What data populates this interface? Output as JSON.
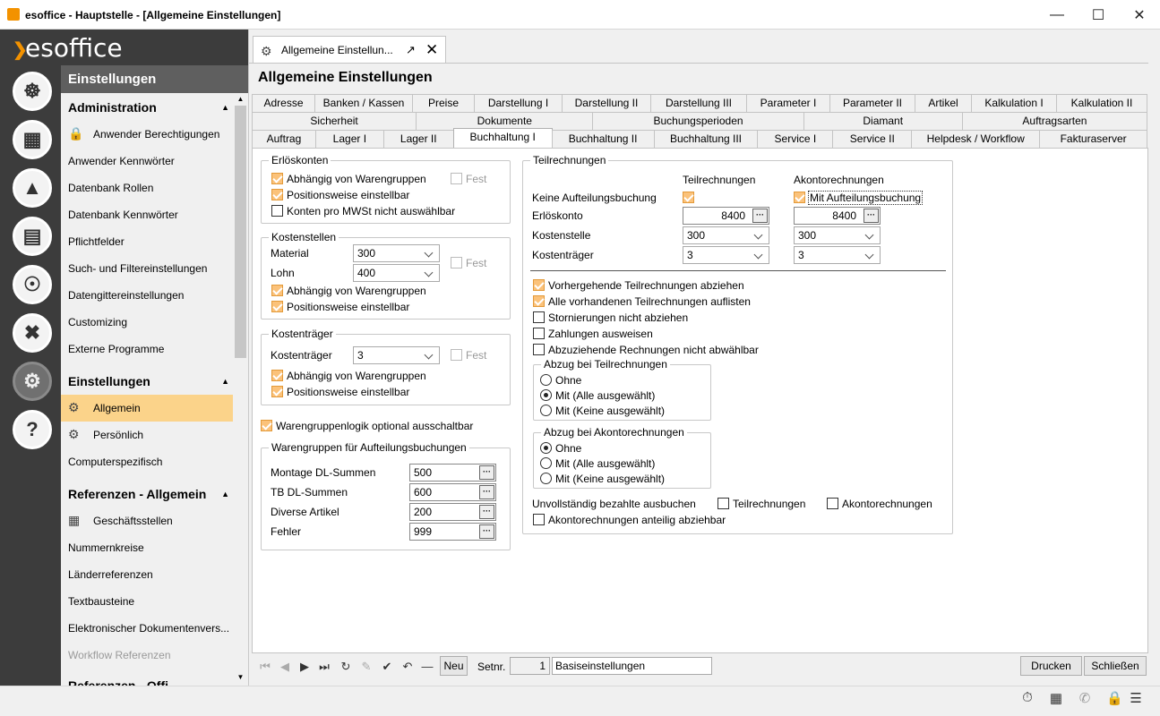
{
  "window": {
    "title": "esoffice - Hauptstelle - [Allgemeine Einstellungen]"
  },
  "brand": {
    "logo_text": "esoffice",
    "accent": "#f39200"
  },
  "nav": {
    "header": "Einstellungen",
    "sections": [
      {
        "title": "Administration",
        "items": [
          "Anwender Berechtigungen",
          "Anwender Kennwörter",
          "Datenbank Rollen",
          "Datenbank Kennwörter",
          "Pflichtfelder",
          "Such- und Filtereinstellungen",
          "Datengittereinstellungen",
          "Customizing",
          "Externe Programme"
        ]
      },
      {
        "title": "Einstellungen",
        "items": [
          "Allgemein",
          "Persönlich",
          "Computerspezifisch"
        ]
      },
      {
        "title": "Referenzen - Allgemein",
        "items": [
          "Geschäftsstellen",
          "Nummernkreise",
          "Länderreferenzen",
          "Textbausteine",
          "Elektronischer Dokumentenvers...",
          "Workflow Referenzen"
        ]
      },
      {
        "title": "Referenzen - Offi..."
      }
    ]
  },
  "doc_tab": {
    "label": "Allgemeine Einstellun..."
  },
  "page_title": "Allgemeine Einstellungen",
  "tabs": {
    "row1": [
      "Adresse",
      "Banken / Kassen",
      "Preise",
      "Darstellung I",
      "Darstellung II",
      "Darstellung III",
      "Parameter I",
      "Parameter II",
      "Artikel",
      "Kalkulation I",
      "Kalkulation II"
    ],
    "row2": [
      "Sicherheit",
      "Dokumente",
      "Buchungsperioden",
      "Diamant",
      "Auftragsarten"
    ],
    "row3": [
      "Auftrag",
      "Lager I",
      "Lager II",
      "Buchhaltung I",
      "Buchhaltung II",
      "Buchhaltung III",
      "Service I",
      "Service II",
      "Helpdesk / Workflow",
      "Fakturaserver"
    ],
    "selected": "Buchhaltung I"
  },
  "erloeskonten": {
    "legend": "Erlöskonten",
    "abh": "Abhängig von Warengruppen",
    "fest": "Fest",
    "pos": "Positionsweise einstellbar",
    "konten": "Konten pro MWSt nicht auswählbar"
  },
  "kostenstellen": {
    "legend": "Kostenstellen",
    "material_label": "Material",
    "material_value": "300",
    "lohn_label": "Lohn",
    "lohn_value": "400",
    "fest": "Fest",
    "abh": "Abhängig von Warengruppen",
    "pos": "Positionsweise einstellbar"
  },
  "kostentraeger": {
    "legend": "Kostenträger",
    "label": "Kostenträger",
    "value": "3",
    "fest": "Fest",
    "abh": "Abhängig von Warengruppen",
    "pos": "Positionsweise einstellbar"
  },
  "warengruppenlogik": "Warengruppenlogik optional ausschaltbar",
  "aufteilung": {
    "legend": "Warengruppen für Aufteilungsbuchungen",
    "rows": [
      {
        "label": "Montage DL-Summen",
        "value": "500"
      },
      {
        "label": "TB DL-Summen",
        "value": "600"
      },
      {
        "label": "Diverse Artikel",
        "value": "200"
      },
      {
        "label": "Fehler",
        "value": "999"
      }
    ]
  },
  "teilrechnungen": {
    "legend": "Teilrechnungen",
    "col_teil": "Teilrechnungen",
    "col_akonto": "Akontorechnungen",
    "keine_label": "Keine Aufteilungsbuchung",
    "mit_label": "Mit Aufteilungsbuchung",
    "erloeskonto_label": "Erlöskonto",
    "erloeskonto_teil": "8400",
    "erloeskonto_akonto": "8400",
    "kostenstelle_label": "Kostenstelle",
    "kostenstelle_teil": "300",
    "kostenstelle_akonto": "300",
    "kostentraeger_label": "Kostenträger",
    "kostentraeger_teil": "3",
    "kostentraeger_akonto": "3",
    "opts": [
      "Vorhergehende Teilrechnungen abziehen",
      "Alle vorhandenen Teilrechnungen auflisten",
      "Stornierungen nicht abziehen",
      "Zahlungen ausweisen",
      "Abzuziehende Rechnungen nicht abwählbar"
    ],
    "abzug_teil": {
      "legend": "Abzug bei Teilrechnungen",
      "options": [
        "Ohne",
        "Mit (Alle ausgewählt)",
        "Mit (Keine ausgewählt)"
      ]
    },
    "abzug_akonto": {
      "legend": "Abzug bei Akontorechnungen",
      "options": [
        "Ohne",
        "Mit (Alle ausgewählt)",
        "Mit (Keine ausgewählt)"
      ]
    },
    "unvoll_label": "Unvollständig bezahlte ausbuchen",
    "unvoll_teil": "Teilrechnungen",
    "unvoll_akonto": "Akontorechnungen",
    "anteilig": "Akontorechnungen anteilig abziehbar"
  },
  "bottom": {
    "neu": "Neu",
    "setnr_label": "Setnr.",
    "setnr_value": "1",
    "set_name": "Basiseinstellungen",
    "drucken": "Drucken",
    "schliessen": "Schließen"
  }
}
